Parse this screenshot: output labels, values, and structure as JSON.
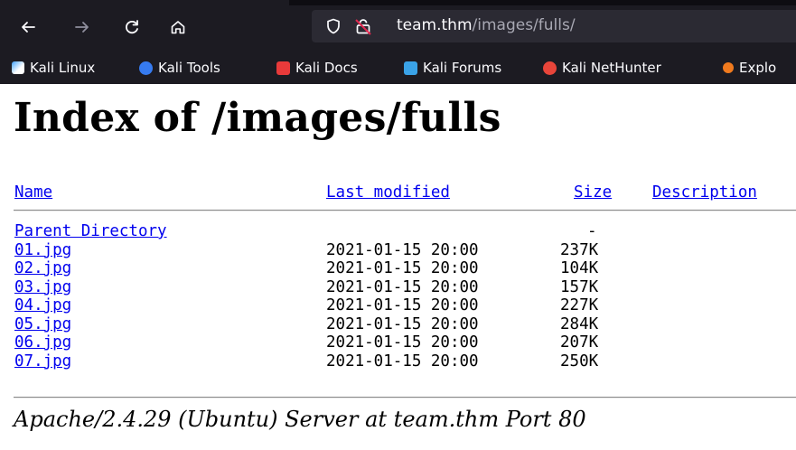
{
  "browser": {
    "url_host": "team.thm",
    "url_path": "/images/fulls/",
    "bookmarks": [
      {
        "label": "Kali Linux",
        "icon": "kali-linux-icon"
      },
      {
        "label": "Kali Tools",
        "icon": "kali-tools-icon"
      },
      {
        "label": "Kali Docs",
        "icon": "kali-docs-icon"
      },
      {
        "label": "Kali Forums",
        "icon": "kali-forums-icon"
      },
      {
        "label": "Kali NetHunter",
        "icon": "kali-nethunter-icon"
      },
      {
        "label": "Explo",
        "icon": "exploit-db-icon"
      }
    ]
  },
  "page": {
    "title": "Index of /images/fulls",
    "columns": {
      "name": "Name",
      "last_modified": "Last modified",
      "size": "Size",
      "description": "Description"
    },
    "parent": {
      "name": "Parent Directory",
      "size": "-"
    },
    "files": [
      {
        "name": "01.jpg",
        "modified": "2021-01-15 20:00",
        "size": "237K"
      },
      {
        "name": "02.jpg",
        "modified": "2021-01-15 20:00",
        "size": "104K"
      },
      {
        "name": "03.jpg",
        "modified": "2021-01-15 20:00",
        "size": "157K"
      },
      {
        "name": "04.jpg",
        "modified": "2021-01-15 20:00",
        "size": "227K"
      },
      {
        "name": "05.jpg",
        "modified": "2021-01-15 20:00",
        "size": "284K"
      },
      {
        "name": "06.jpg",
        "modified": "2021-01-15 20:00",
        "size": "207K"
      },
      {
        "name": "07.jpg",
        "modified": "2021-01-15 20:00",
        "size": "250K"
      }
    ],
    "footer": "Apache/2.4.29 (Ubuntu) Server at team.thm Port 80"
  },
  "colors": {
    "link": "#0000ee",
    "chrome_bg": "#1c1b22",
    "urlbar_bg": "#2b2a33"
  }
}
